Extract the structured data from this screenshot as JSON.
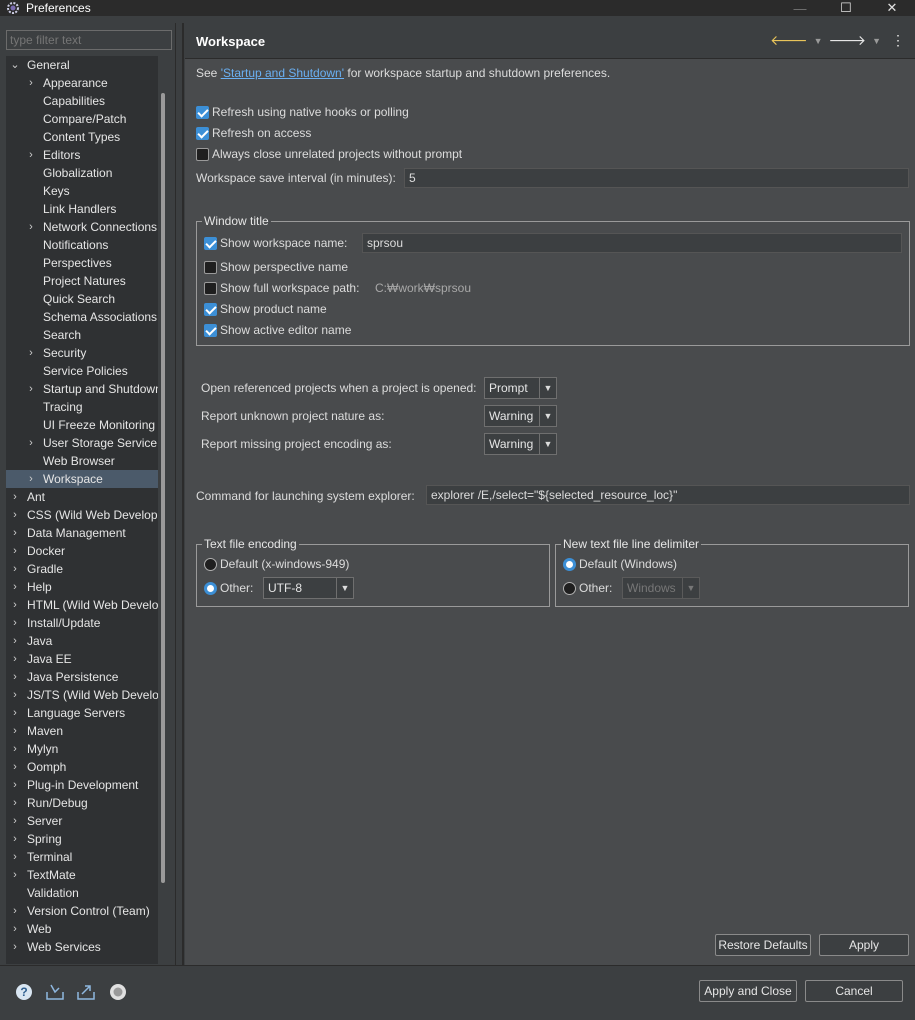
{
  "window": {
    "title": "Preferences",
    "minimize": "—",
    "maximize": "☐",
    "close": "✕"
  },
  "filter": {
    "placeholder": "type filter text"
  },
  "tree": [
    {
      "label": "General",
      "level": 0,
      "expanded": true
    },
    {
      "label": "Appearance",
      "level": 1,
      "expandable": true
    },
    {
      "label": "Capabilities",
      "level": 1
    },
    {
      "label": "Compare/Patch",
      "level": 1
    },
    {
      "label": "Content Types",
      "level": 1
    },
    {
      "label": "Editors",
      "level": 1,
      "expandable": true
    },
    {
      "label": "Globalization",
      "level": 1
    },
    {
      "label": "Keys",
      "level": 1
    },
    {
      "label": "Link Handlers",
      "level": 1
    },
    {
      "label": "Network Connections",
      "level": 1,
      "expandable": true
    },
    {
      "label": "Notifications",
      "level": 1
    },
    {
      "label": "Perspectives",
      "level": 1
    },
    {
      "label": "Project Natures",
      "level": 1
    },
    {
      "label": "Quick Search",
      "level": 1
    },
    {
      "label": "Schema Associations",
      "level": 1
    },
    {
      "label": "Search",
      "level": 1
    },
    {
      "label": "Security",
      "level": 1,
      "expandable": true
    },
    {
      "label": "Service Policies",
      "level": 1
    },
    {
      "label": "Startup and Shutdown",
      "level": 1,
      "expandable": true
    },
    {
      "label": "Tracing",
      "level": 1
    },
    {
      "label": "UI Freeze Monitoring",
      "level": 1
    },
    {
      "label": "User Storage Service",
      "level": 1,
      "expandable": true
    },
    {
      "label": "Web Browser",
      "level": 1
    },
    {
      "label": "Workspace",
      "level": 1,
      "expandable": true,
      "selected": true
    },
    {
      "label": "Ant",
      "level": 0,
      "expandable": true
    },
    {
      "label": "CSS (Wild Web Developer)",
      "level": 0,
      "expandable": true
    },
    {
      "label": "Data Management",
      "level": 0,
      "expandable": true
    },
    {
      "label": "Docker",
      "level": 0,
      "expandable": true
    },
    {
      "label": "Gradle",
      "level": 0,
      "expandable": true
    },
    {
      "label": "Help",
      "level": 0,
      "expandable": true
    },
    {
      "label": "HTML (Wild Web Developer)",
      "level": 0,
      "expandable": true
    },
    {
      "label": "Install/Update",
      "level": 0,
      "expandable": true
    },
    {
      "label": "Java",
      "level": 0,
      "expandable": true
    },
    {
      "label": "Java EE",
      "level": 0,
      "expandable": true
    },
    {
      "label": "Java Persistence",
      "level": 0,
      "expandable": true
    },
    {
      "label": "JS/TS (Wild Web Developer)",
      "level": 0,
      "expandable": true
    },
    {
      "label": "Language Servers",
      "level": 0,
      "expandable": true
    },
    {
      "label": "Maven",
      "level": 0,
      "expandable": true
    },
    {
      "label": "Mylyn",
      "level": 0,
      "expandable": true
    },
    {
      "label": "Oomph",
      "level": 0,
      "expandable": true
    },
    {
      "label": "Plug-in Development",
      "level": 0,
      "expandable": true
    },
    {
      "label": "Run/Debug",
      "level": 0,
      "expandable": true
    },
    {
      "label": "Server",
      "level": 0,
      "expandable": true
    },
    {
      "label": "Spring",
      "level": 0,
      "expandable": true
    },
    {
      "label": "Terminal",
      "level": 0,
      "expandable": true
    },
    {
      "label": "TextMate",
      "level": 0,
      "expandable": true
    },
    {
      "label": "Validation",
      "level": 0
    },
    {
      "label": "Version Control (Team)",
      "level": 0,
      "expandable": true
    },
    {
      "label": "Web",
      "level": 0,
      "expandable": true
    },
    {
      "label": "Web Services",
      "level": 0,
      "expandable": true
    }
  ],
  "page": {
    "title": "Workspace",
    "intro_prefix": "See ",
    "intro_link": "'Startup and Shutdown'",
    "intro_suffix": " for workspace startup and shutdown preferences.",
    "refresh_native": {
      "label": "Refresh using native hooks or polling",
      "checked": true
    },
    "refresh_access": {
      "label": "Refresh on access",
      "checked": true
    },
    "always_close": {
      "label": "Always close unrelated projects without prompt",
      "checked": false
    },
    "save_interval": {
      "label": "Workspace save interval (in minutes):",
      "value": "5"
    },
    "window_title": {
      "legend": "Window title",
      "show_workspace_name": {
        "label": "Show workspace name:",
        "checked": true,
        "value": "sprsou"
      },
      "show_perspective_name": {
        "label": "Show perspective name",
        "checked": false
      },
      "show_full_path": {
        "label": "Show full workspace path:",
        "checked": false,
        "value": "C:₩work₩sprsou"
      },
      "show_product_name": {
        "label": "Show product name",
        "checked": true
      },
      "show_active_editor": {
        "label": "Show active editor name",
        "checked": true
      }
    },
    "open_referenced": {
      "label": "Open referenced projects when a project is opened:",
      "value": "Prompt"
    },
    "unknown_nature": {
      "label": "Report unknown project nature as:",
      "value": "Warning"
    },
    "missing_encoding": {
      "label": "Report missing project encoding as:",
      "value": "Warning"
    },
    "explorer_command": {
      "label": "Command for launching system explorer:",
      "value": "explorer /E,/select=\"${selected_resource_loc}\""
    },
    "text_encoding": {
      "legend": "Text file encoding",
      "default_label": "Default (x-windows-949)",
      "other_label": "Other:",
      "selected": "other",
      "other_value": "UTF-8"
    },
    "line_delimiter": {
      "legend": "New text file line delimiter",
      "default_label": "Default (Windows)",
      "other_label": "Other:",
      "selected": "default",
      "other_value": "Windows"
    },
    "restore_defaults": "Restore Defaults",
    "apply": "Apply"
  },
  "footer": {
    "apply_close": "Apply and Close",
    "cancel": "Cancel",
    "icons": [
      "help-icon",
      "import-icon",
      "export-icon",
      "oomph-icon"
    ]
  },
  "colors": {
    "accent": "#3c8fd6",
    "link": "#6ab0f3",
    "nav_arrow": "#e8c45a"
  }
}
